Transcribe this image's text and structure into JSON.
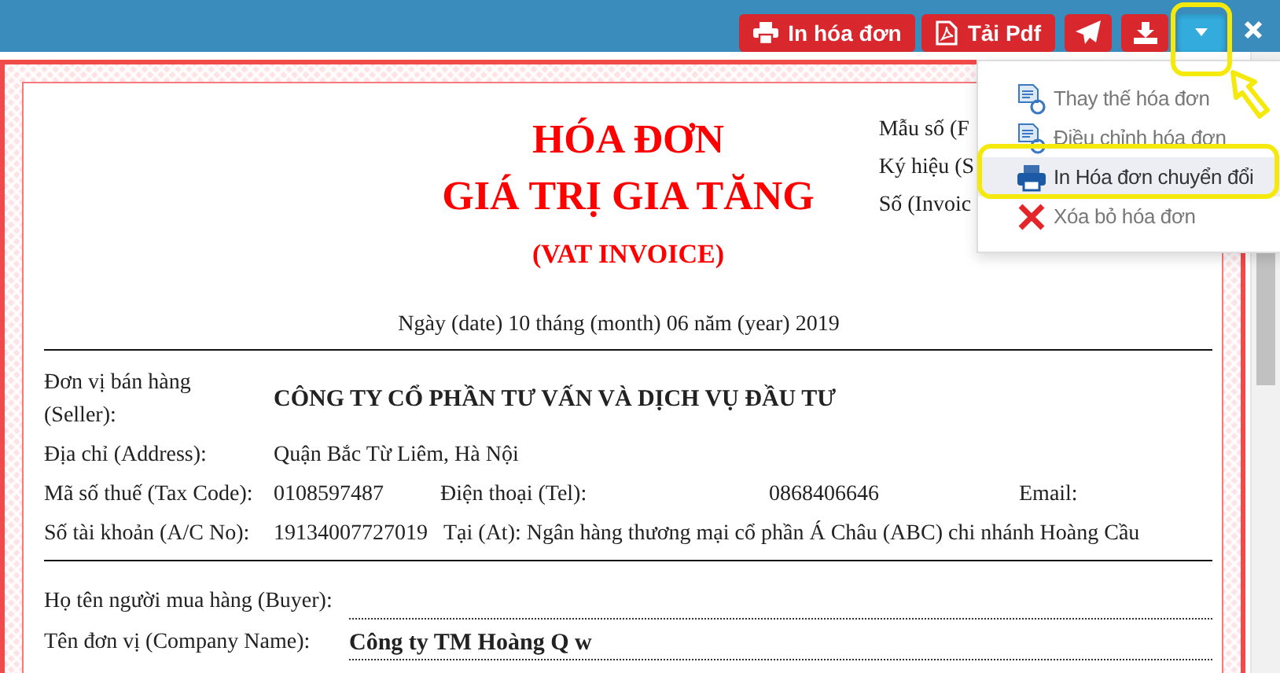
{
  "toolbar": {
    "buttons": [
      {
        "kind": "text",
        "label": "In hóa đơn"
      },
      {
        "kind": "text",
        "label": "Tải Pdf"
      },
      {
        "kind": "icon"
      },
      {
        "kind": "icon"
      },
      {
        "kind": "dropdown",
        "expanded": true
      },
      {
        "kind": "close"
      }
    ]
  },
  "menu": {
    "items": [
      {
        "label": "Thay thế hóa đơn",
        "selected": false
      },
      {
        "label": "Điều chỉnh hóa đơn",
        "selected": false
      },
      {
        "label": "In Hóa đơn chuyển đổi",
        "selected": true
      },
      {
        "label": "Xóa bỏ hóa đơn",
        "selected": false
      }
    ]
  },
  "invoice": {
    "title": [
      "HÓA ĐƠN",
      "GIÁ TRỊ GIA TĂNG"
    ],
    "subtitle": "(VAT INVOICE)",
    "meta": [
      "Mẫu số (F",
      "Ký hiệu (S",
      "Số (Invoic"
    ],
    "date": "Ngày (date) 10 tháng (month) 06 năm (year) 2019",
    "seller": [
      {
        "kind": "name",
        "label": "Đơn vị bán hàng (Seller):",
        "value": "CÔNG TY CỔ PHẦN TƯ VẤN VÀ DỊCH VỤ ĐẦU TƯ"
      },
      {
        "kind": "plain",
        "label": "Địa chỉ (Address):",
        "value": "Quận Bắc Từ Liêm, Hà Nội"
      },
      {
        "kind": "tax",
        "label": "Mã số thuế (Tax Code):",
        "value": "0108597487",
        "phone_label": "Điện thoại (Tel):",
        "phone": "0868406646",
        "email_label": "Email:"
      },
      {
        "kind": "bank",
        "label": "Số tài khoản (A/C No):",
        "value": "19134007727019",
        "bank": "Tại (At): Ngân hàng thương mại cổ phần Á Châu (ABC) chi nhánh Hoàng Cầu"
      }
    ],
    "buyer": [
      {
        "label": "Họ tên người mua hàng (Buyer):"
      },
      {
        "label": "Tên đơn vị (Company Name):",
        "value": "Công ty TM Hoàng Q w"
      }
    ]
  }
}
